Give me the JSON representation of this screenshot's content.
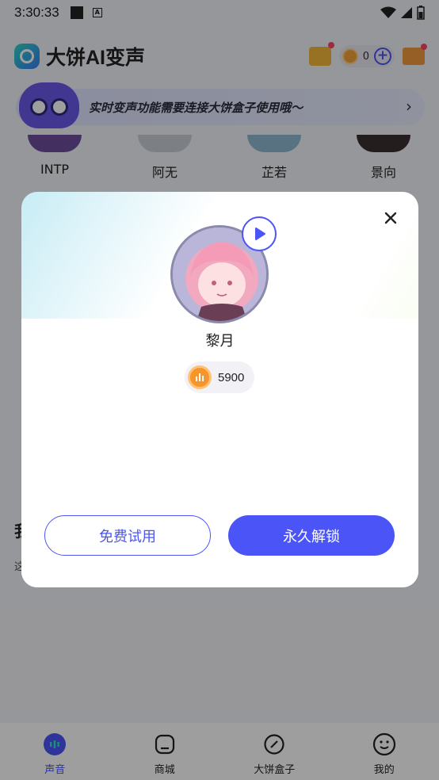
{
  "status_bar": {
    "time": "3:30:33"
  },
  "header": {
    "app_title": "大饼AI变声",
    "coin_count": "0"
  },
  "banner": {
    "text": "实时变声功能需要连接大饼盒子使用哦～"
  },
  "voices": [
    {
      "name": "INTP"
    },
    {
      "name": "阿无"
    },
    {
      "name": "芷若"
    },
    {
      "name": "景向"
    }
  ],
  "background_section": {
    "heading": "我",
    "subtext": "这"
  },
  "modal": {
    "character_name": "黎月",
    "price": "5900",
    "trial_label": "免费试用",
    "unlock_label": "永久解锁"
  },
  "bottom_nav": {
    "items": [
      {
        "label": "声音",
        "icon": "voice-icon",
        "active": true
      },
      {
        "label": "商城",
        "icon": "shop-icon",
        "active": false
      },
      {
        "label": "大饼盒子",
        "icon": "link-icon",
        "active": false
      },
      {
        "label": "我的",
        "icon": "smile-icon",
        "active": false
      }
    ]
  },
  "colors": {
    "accent": "#4b55f7",
    "coin": "#f6952c"
  }
}
